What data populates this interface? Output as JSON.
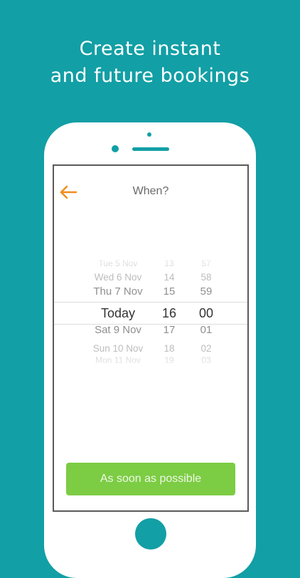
{
  "headline": {
    "line1": "Create instant",
    "line2": "and future bookings"
  },
  "nav": {
    "title": "When?",
    "back_icon": "arrow-left-icon",
    "accent_color": "#f08c1e"
  },
  "picker": {
    "rows": [
      {
        "day": "Tue 5 Nov",
        "hour": "13",
        "minute": "57"
      },
      {
        "day": "Wed 6 Nov",
        "hour": "14",
        "minute": "58"
      },
      {
        "day": "Thu 7 Nov",
        "hour": "15",
        "minute": "59"
      },
      {
        "day": "Today",
        "hour": "16",
        "minute": "00"
      },
      {
        "day": "Sat 9 Nov",
        "hour": "17",
        "minute": "01"
      },
      {
        "day": "Sun 10 Nov",
        "hour": "18",
        "minute": "02"
      },
      {
        "day": "Mon 11 Nov",
        "hour": "19",
        "minute": "03"
      }
    ],
    "selected_index": 3
  },
  "cta": {
    "label": "As soon as possible",
    "color": "#7ccc44"
  },
  "colors": {
    "background": "#129fa5",
    "phone": "#ffffff"
  }
}
